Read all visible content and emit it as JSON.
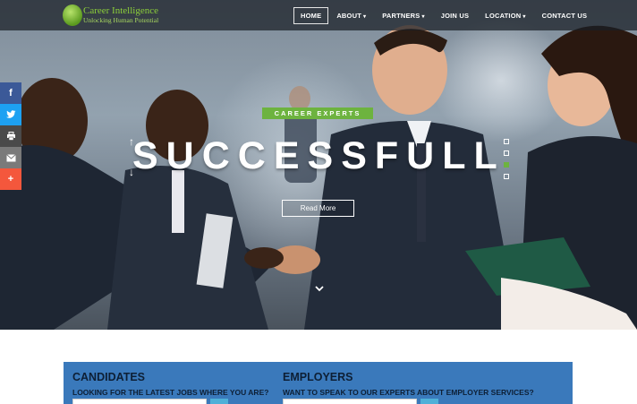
{
  "brand": {
    "name": "Career Intelligence",
    "tagline": "Unlocking Human Potential"
  },
  "nav": {
    "items": [
      {
        "label": "HOME",
        "active": true,
        "dropdown": false
      },
      {
        "label": "ABOUT",
        "active": false,
        "dropdown": true
      },
      {
        "label": "PARTNERS",
        "active": false,
        "dropdown": true
      },
      {
        "label": "JOIN US",
        "active": false,
        "dropdown": false
      },
      {
        "label": "LOCATION",
        "active": false,
        "dropdown": true
      },
      {
        "label": "CONTACT US",
        "active": false,
        "dropdown": false
      }
    ]
  },
  "social": {
    "icons": [
      "facebook-icon",
      "twitter-icon",
      "print-icon",
      "email-icon",
      "plus-icon"
    ]
  },
  "hero": {
    "badge": "CAREER EXPERTS",
    "headline": "SUCCESSFULL",
    "button": "Read More",
    "slide_count": 4,
    "active_slide": 3
  },
  "panel": {
    "candidates": {
      "title": "CANDIDATES",
      "subtitle": "LOOKING FOR THE LATEST JOBS WHERE YOU ARE?"
    },
    "employers": {
      "title": "EMPLOYERS",
      "subtitle": "WANT TO SPEAK TO OUR EXPERTS ABOUT EMPLOYER SERVICES?"
    }
  },
  "colors": {
    "accent_green": "#6db33f",
    "panel_blue": "#3a79bb",
    "topbar": "#191e26"
  }
}
